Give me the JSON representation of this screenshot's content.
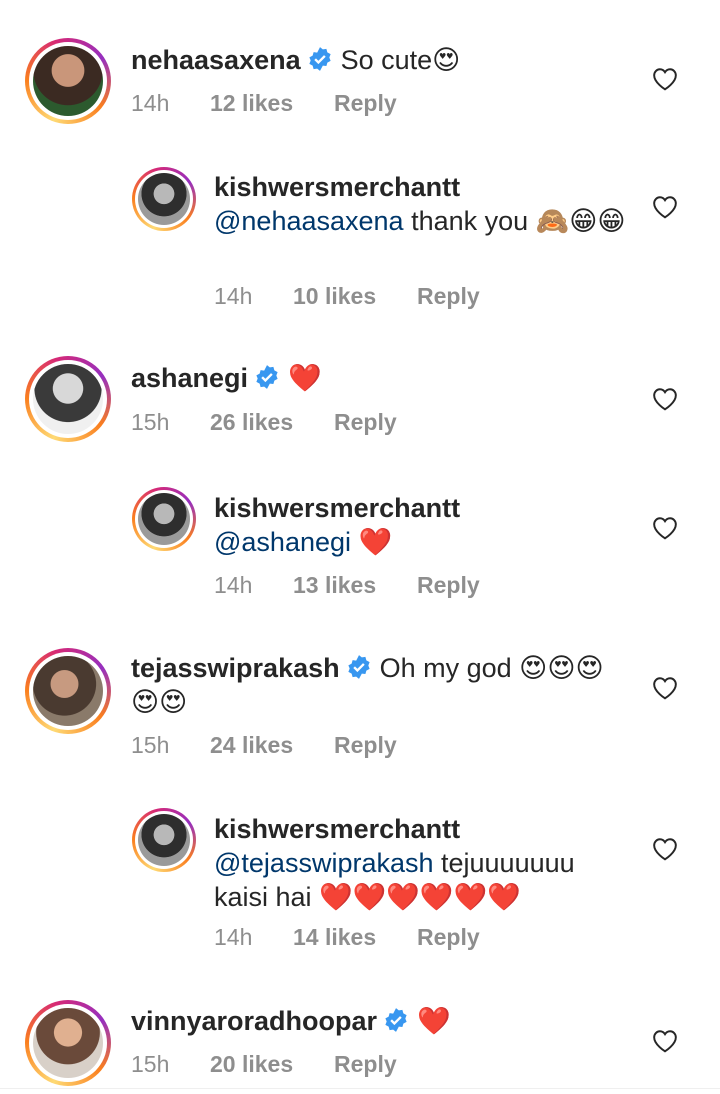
{
  "comments": [
    {
      "username": "nehaasaxena",
      "verified": true,
      "text": "So cute😍",
      "ts": "14h",
      "likes": "12 likes",
      "reply": "Reply"
    },
    {
      "username": "kishwersmerchantt",
      "mention": "@nehaasaxena",
      "text": " thank you 🙈😁😁",
      "ts": "14h",
      "likes": "10 likes",
      "reply": "Reply"
    },
    {
      "username": "ashanegi",
      "verified": true,
      "text": "❤️",
      "ts": "15h",
      "likes": "26 likes",
      "reply": "Reply"
    },
    {
      "username": "kishwersmerchantt",
      "mention": "@ashanegi",
      "text": " ❤️",
      "ts": "14h",
      "likes": "13 likes",
      "reply": "Reply"
    },
    {
      "username": "tejasswiprakash",
      "verified": true,
      "text": "Oh my god 😍😍😍😍😍",
      "ts": "15h",
      "likes": "24 likes",
      "reply": "Reply"
    },
    {
      "username": "kishwersmerchantt",
      "mention": "@tejasswiprakash",
      "text": " tejuuuuuuu kaisi hai ❤️❤️❤️❤️❤️❤️",
      "ts": "14h",
      "likes": "14 likes",
      "reply": "Reply"
    },
    {
      "username": "vinnyaroradhoopar",
      "verified": true,
      "text": "❤️",
      "ts": "15h",
      "likes": "20 likes",
      "reply": "Reply"
    }
  ],
  "colors": {
    "verified": "#3897f0",
    "mention": "#00376b",
    "meta": "#8e8e8e",
    "text": "#262626"
  },
  "icons": {
    "like": "heart-outline-icon",
    "verified": "verified-badge-icon"
  }
}
